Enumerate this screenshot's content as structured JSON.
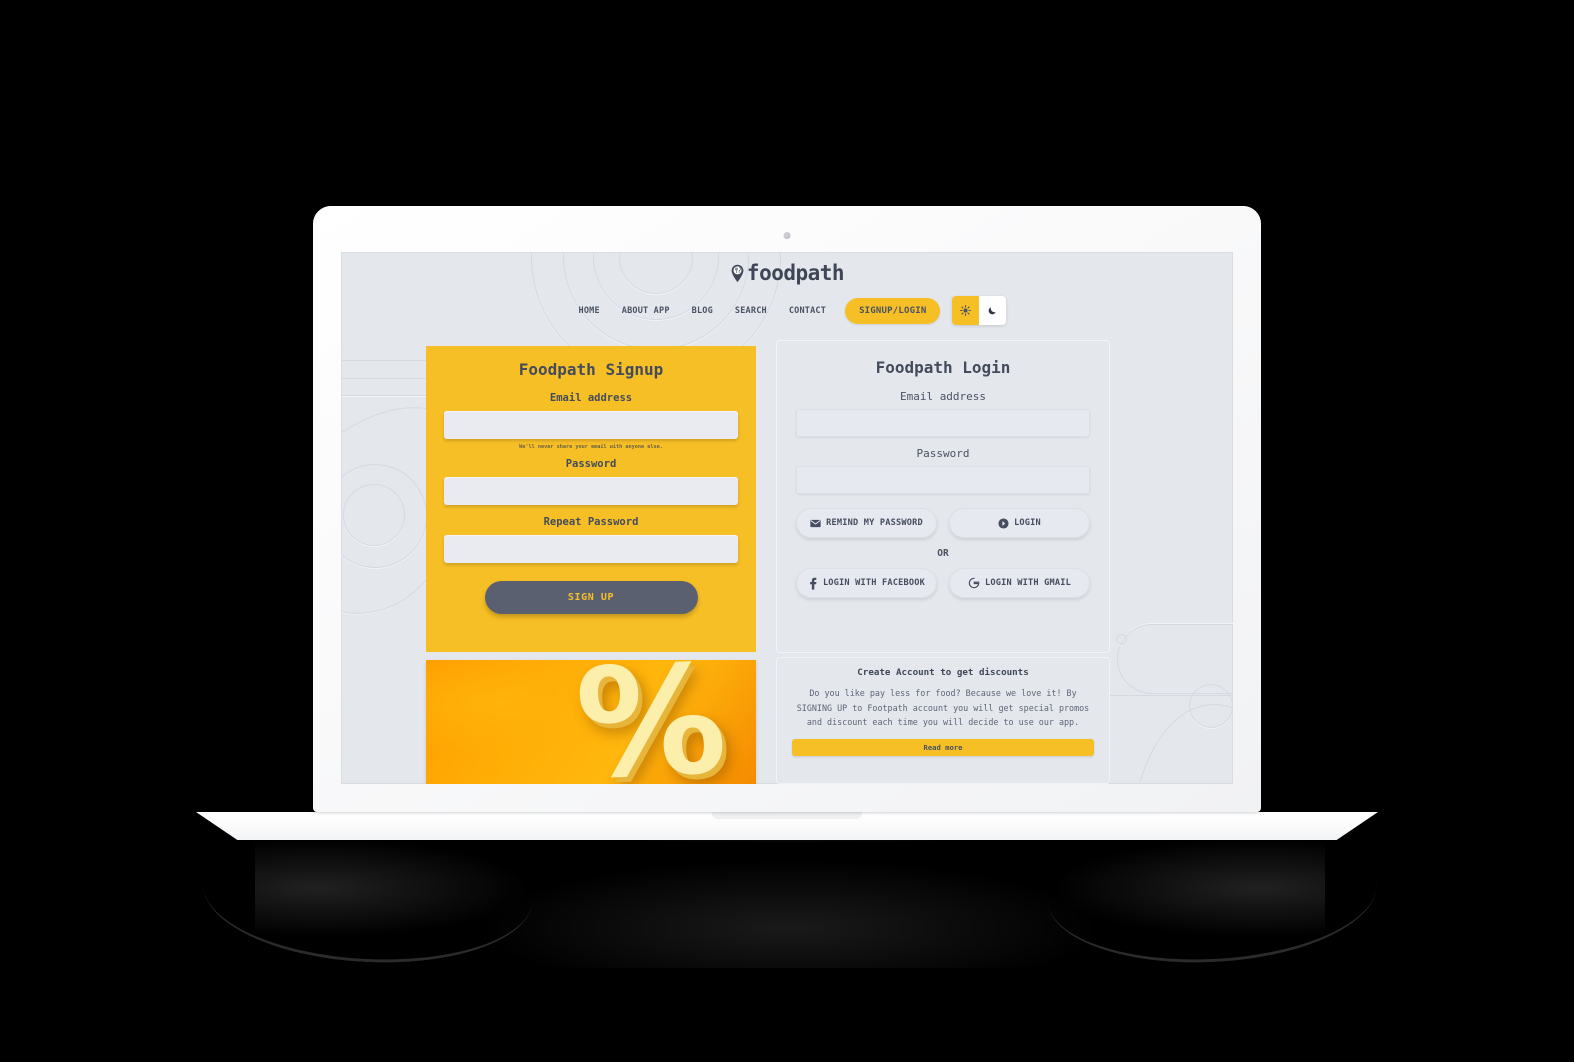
{
  "colors": {
    "accent_yellow": "#F7BF26",
    "page_bg": "#E4E7EC",
    "dark_slate": "#5A6070",
    "text_slate": "#434B5C",
    "promo_orange": "#FFAE06"
  },
  "brand": {
    "name": "foodpath",
    "logo_icon": "location-pin-fork-icon"
  },
  "nav": {
    "links": [
      {
        "label": "HOME"
      },
      {
        "label": "ABOUT APP"
      },
      {
        "label": "BLOG"
      },
      {
        "label": "SEARCH"
      },
      {
        "label": "CONTACT"
      }
    ],
    "cta_label": "SIGNUP/LOGIN",
    "theme_toggle": {
      "light_icon": "sun-icon",
      "dark_icon": "moon-icon"
    }
  },
  "signup": {
    "title": "Foodpath Signup",
    "email_label": "Email address",
    "email_value": "",
    "email_placeholder": "",
    "email_helper": "We'll never share your email with anyone else.",
    "password_label": "Password",
    "password_value": "",
    "repeat_label": "Repeat Password",
    "repeat_value": "",
    "submit_label": "SIGN UP"
  },
  "login": {
    "title": "Foodpath Login",
    "email_label": "Email address",
    "email_value": "",
    "password_label": "Password",
    "password_value": "",
    "remind_label": "REMIND MY PASSWORD",
    "remind_icon": "envelope-icon",
    "login_label": "LOGIN",
    "login_icon": "arrow-circle-right-icon",
    "or_label": "OR",
    "facebook_label": "LOGIN WITH FACEBOOK",
    "facebook_icon": "facebook-f-icon",
    "gmail_label": "LOGIN WITH GMAIL",
    "gmail_icon": "google-g-icon"
  },
  "promo": {
    "image_glyph": "%",
    "image_alt": "percent-discount-image",
    "title": "Create Account to get discounts",
    "body": "Do you like pay less for food? Because we love it! By SIGNING UP to Footpath account you will get special promos and discount each time you will decide to use our app.",
    "read_more_label": "Read more"
  }
}
